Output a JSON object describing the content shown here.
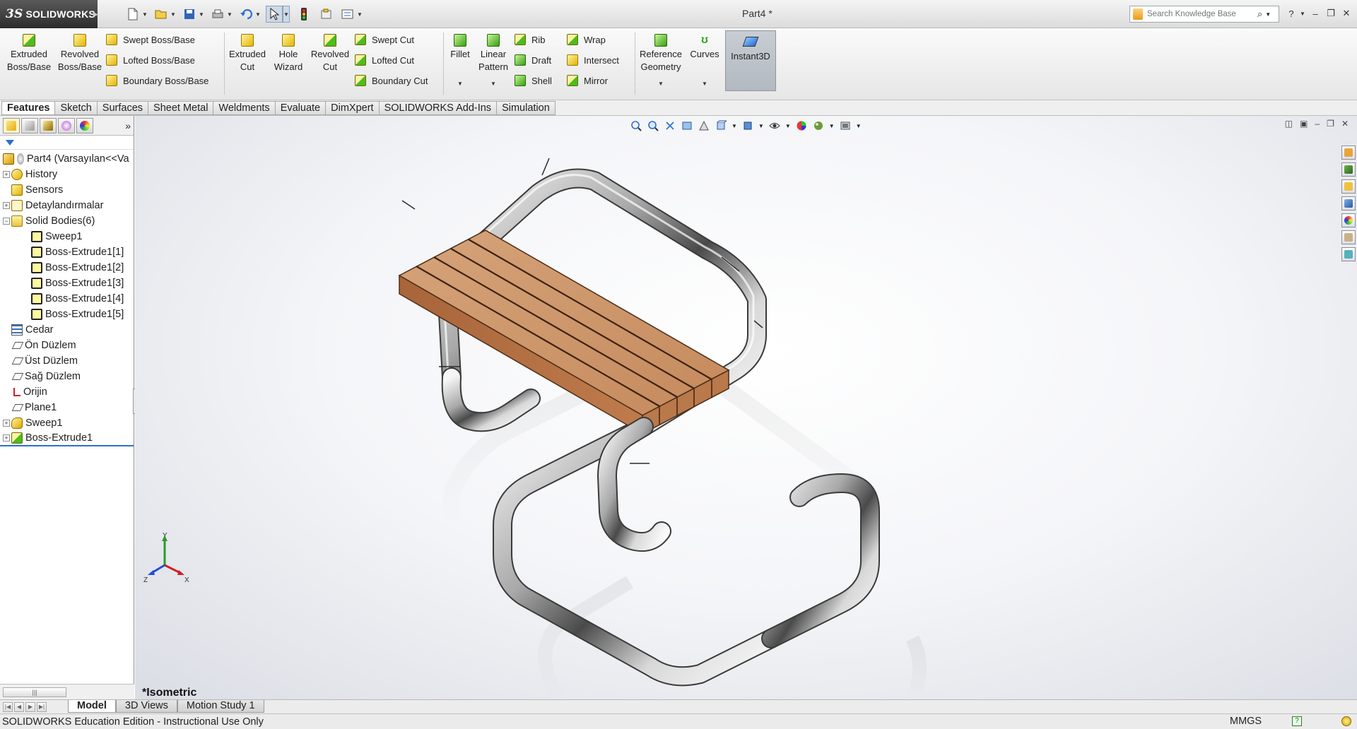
{
  "app": {
    "brand": "SOLIDWORKS",
    "document_title": "Part4 *",
    "search_placeholder": "Search Knowledge Base"
  },
  "ribbon": {
    "groups": {
      "extruded_boss": "Extruded\nBoss/Base",
      "revolved_boss": "Revolved\nBoss/Base",
      "swept_boss": "Swept Boss/Base",
      "lofted_boss": "Lofted Boss/Base",
      "boundary_boss": "Boundary Boss/Base",
      "extruded_cut": "Extruded\nCut",
      "hole_wizard": "Hole\nWizard",
      "revolved_cut": "Revolved\nCut",
      "swept_cut": "Swept Cut",
      "lofted_cut": "Lofted Cut",
      "boundary_cut": "Boundary Cut",
      "fillet": "Fillet",
      "linear_pattern": "Linear\nPattern",
      "rib": "Rib",
      "draft": "Draft",
      "shell": "Shell",
      "wrap": "Wrap",
      "intersect": "Intersect",
      "mirror": "Mirror",
      "reference_geometry": "Reference\nGeometry",
      "curves": "Curves",
      "instant3d": "Instant3D"
    }
  },
  "cm_tabs": [
    "Features",
    "Sketch",
    "Surfaces",
    "Sheet Metal",
    "Weldments",
    "Evaluate",
    "DimXpert",
    "SOLIDWORKS Add-Ins",
    "Simulation"
  ],
  "tree": {
    "root": "Part4  (Varsayılan<<Va",
    "items": [
      {
        "label": "History",
        "icon": "history-icon",
        "exp": true,
        "indent": 0
      },
      {
        "label": "Sensors",
        "icon": "sensors-icon",
        "exp": false,
        "indent": 0
      },
      {
        "label": "Detaylandırmalar",
        "icon": "annotations-icon",
        "exp": true,
        "indent": 0
      },
      {
        "label": "Solid Bodies(6)",
        "icon": "solid-bodies-folder-icon",
        "exp": "open",
        "indent": 0
      },
      {
        "label": "Sweep1",
        "icon": "solid-body-icon",
        "exp": false,
        "indent": 1
      },
      {
        "label": "Boss-Extrude1[1]",
        "icon": "solid-body-icon",
        "exp": false,
        "indent": 1
      },
      {
        "label": "Boss-Extrude1[2]",
        "icon": "solid-body-icon",
        "exp": false,
        "indent": 1
      },
      {
        "label": "Boss-Extrude1[3]",
        "icon": "solid-body-icon",
        "exp": false,
        "indent": 1
      },
      {
        "label": "Boss-Extrude1[4]",
        "icon": "solid-body-icon",
        "exp": false,
        "indent": 1
      },
      {
        "label": "Boss-Extrude1[5]",
        "icon": "solid-body-icon",
        "exp": false,
        "indent": 1
      },
      {
        "label": "Cedar",
        "icon": "material-icon",
        "exp": false,
        "indent": 0
      },
      {
        "label": "Ön Düzlem",
        "icon": "plane-icon",
        "exp": false,
        "indent": 0
      },
      {
        "label": "Üst Düzlem",
        "icon": "plane-icon",
        "exp": false,
        "indent": 0
      },
      {
        "label": "Sağ Düzlem",
        "icon": "plane-icon",
        "exp": false,
        "indent": 0
      },
      {
        "label": "Orijin",
        "icon": "origin-icon",
        "exp": false,
        "indent": 0
      },
      {
        "label": "Plane1",
        "icon": "plane-icon",
        "exp": false,
        "indent": 0
      },
      {
        "label": "Sweep1",
        "icon": "sweep-feature-icon",
        "exp": true,
        "indent": 0
      },
      {
        "label": "Boss-Extrude1",
        "icon": "extrude-feature-icon",
        "exp": true,
        "indent": 0
      }
    ]
  },
  "viewport": {
    "view_name": "*Isometric",
    "triad": {
      "x": "X",
      "y": "Y",
      "z": "Z"
    }
  },
  "bottom_tabs": [
    "Model",
    "3D Views",
    "Motion Study 1"
  ],
  "status": {
    "text": "SOLIDWORKS Education Edition - Instructional Use Only",
    "units": "MMGS",
    "help": "?"
  },
  "colors": {
    "wood": "#c98f62",
    "chrome": "#b8b8b8",
    "accent": "#2b6fd0"
  }
}
